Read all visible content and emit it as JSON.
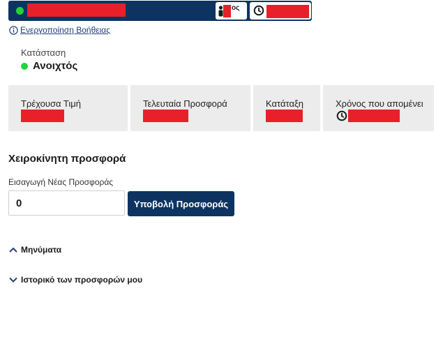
{
  "header": {
    "rank_suffix": "ος",
    "icons": {
      "status": "status-dot",
      "rank": "person-icon",
      "time": "clock-icon"
    }
  },
  "help": {
    "link": "Ενεργοποίηση Βοήθειας",
    "icon": "info-icon"
  },
  "status": {
    "label": "Κατάσταση",
    "value": "Ανοιχτός"
  },
  "cards": [
    {
      "label": "Τρέχουσα Τιμή"
    },
    {
      "label": "Τελευταία Προσφορά"
    },
    {
      "label": "Κατάταξη"
    },
    {
      "label": "Χρόνος που απομένει"
    }
  ],
  "manual": {
    "title": "Χειροκίνητη προσφορά",
    "input_label": "Εισαγωγή Νέας Προσφοράς",
    "input_value": "0",
    "submit": "Υποβολή Προσφοράς"
  },
  "sections": {
    "messages": "Μηνύματα",
    "history": "Ιστορικό των προσφορών μου"
  },
  "colors": {
    "navy": "#0d3461",
    "green": "#22d43a",
    "redaction": "#e8202a",
    "card_bg": "#ececec",
    "link": "#1f3f73"
  }
}
